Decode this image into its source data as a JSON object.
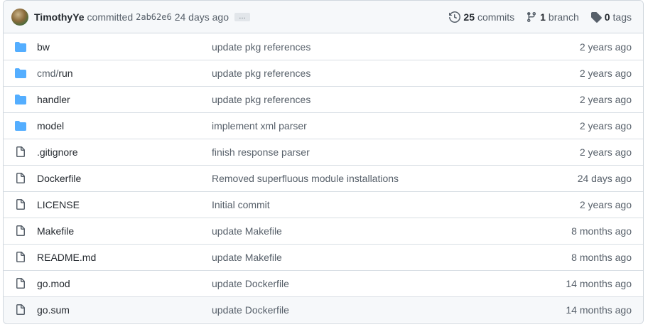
{
  "header": {
    "author": "TimothyYe",
    "committed_text": "committed",
    "sha": "2ab62e6",
    "when": "24 days ago",
    "ellipsis": "…",
    "commits_count": "25",
    "commits_label": "commits",
    "branch_count": "1",
    "branch_label": "branch",
    "tags_count": "0",
    "tags_label": "tags"
  },
  "files": [
    {
      "type": "dir",
      "prefix": "",
      "name": "bw",
      "message": "update pkg references",
      "age": "2 years ago"
    },
    {
      "type": "dir",
      "prefix": "cmd/",
      "name": "run",
      "message": "update pkg references",
      "age": "2 years ago"
    },
    {
      "type": "dir",
      "prefix": "",
      "name": "handler",
      "message": "update pkg references",
      "age": "2 years ago"
    },
    {
      "type": "dir",
      "prefix": "",
      "name": "model",
      "message": "implement xml parser",
      "age": "2 years ago"
    },
    {
      "type": "file",
      "prefix": "",
      "name": ".gitignore",
      "message": "finish response parser",
      "age": "2 years ago"
    },
    {
      "type": "file",
      "prefix": "",
      "name": "Dockerfile",
      "message": "Removed superfluous module installations",
      "age": "24 days ago"
    },
    {
      "type": "file",
      "prefix": "",
      "name": "LICENSE",
      "message": "Initial commit",
      "age": "2 years ago"
    },
    {
      "type": "file",
      "prefix": "",
      "name": "Makefile",
      "message": "update Makefile",
      "age": "8 months ago"
    },
    {
      "type": "file",
      "prefix": "",
      "name": "README.md",
      "message": "update Makefile",
      "age": "8 months ago"
    },
    {
      "type": "file",
      "prefix": "",
      "name": "go.mod",
      "message": "update Dockerfile",
      "age": "14 months ago"
    },
    {
      "type": "file",
      "prefix": "",
      "name": "go.sum",
      "message": "update Dockerfile",
      "age": "14 months ago"
    }
  ],
  "icons": {
    "dir": "folder-icon",
    "file": "file-icon"
  },
  "colors": {
    "folder": "#54aeff",
    "file_icon": "#57606a",
    "header_bg": "#f6f8fa",
    "border": "#d0d7de"
  }
}
